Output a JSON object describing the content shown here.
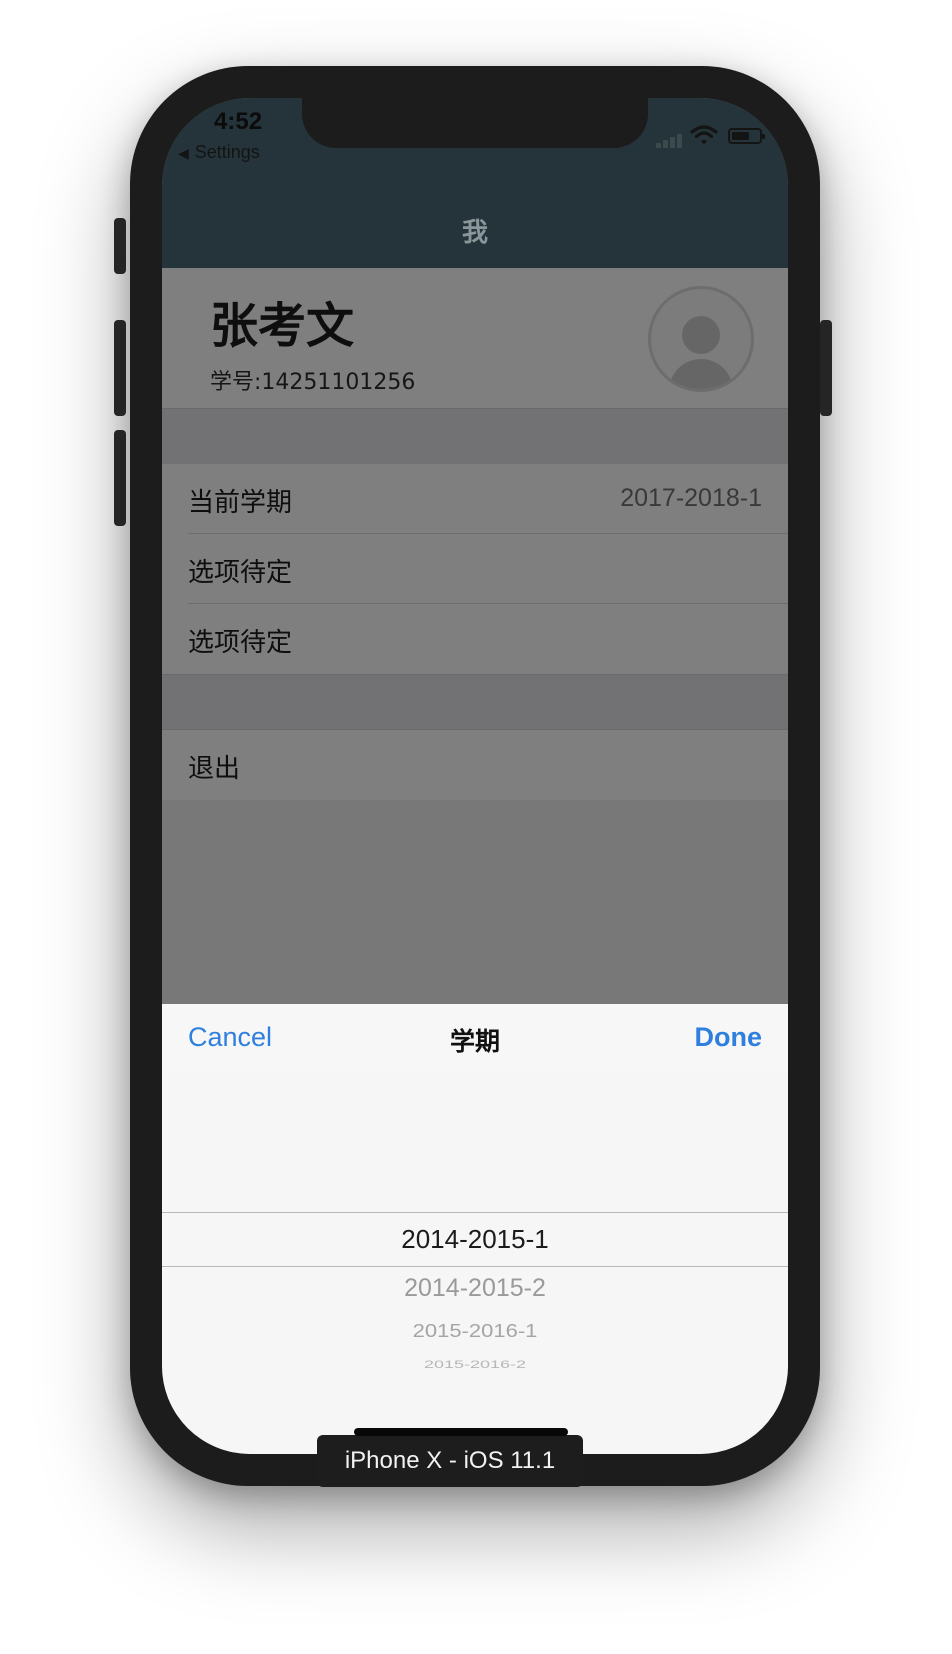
{
  "status_bar": {
    "time": "4:52",
    "back_label": "Settings",
    "signal_icon": "cellular-signal-icon",
    "wifi_icon": "wifi-icon",
    "battery_icon": "battery-icon"
  },
  "navbar": {
    "title": "我"
  },
  "profile": {
    "name": "张考文",
    "student_id": "学号:14251101256",
    "avatar_icon": "user-avatar-icon"
  },
  "settings_rows": [
    {
      "label": "当前学期",
      "value": "2017-2018-1"
    },
    {
      "label": "选项待定",
      "value": ""
    },
    {
      "label": "选项待定",
      "value": ""
    }
  ],
  "logout": {
    "label": "退出"
  },
  "picker": {
    "cancel_label": "Cancel",
    "title": "学期",
    "done_label": "Done",
    "options": [
      "2014-2015-1",
      "2014-2015-2",
      "2015-2016-1",
      "2015-2016-2"
    ],
    "selected_value": "2014-2015-1"
  },
  "device_label": "iPhone X - iOS 11.1",
  "colors": {
    "accent": "#2f7fde",
    "navbar": "#24343a",
    "overlay": "#7f7f7f",
    "picker_background": "#f6f6f6"
  }
}
